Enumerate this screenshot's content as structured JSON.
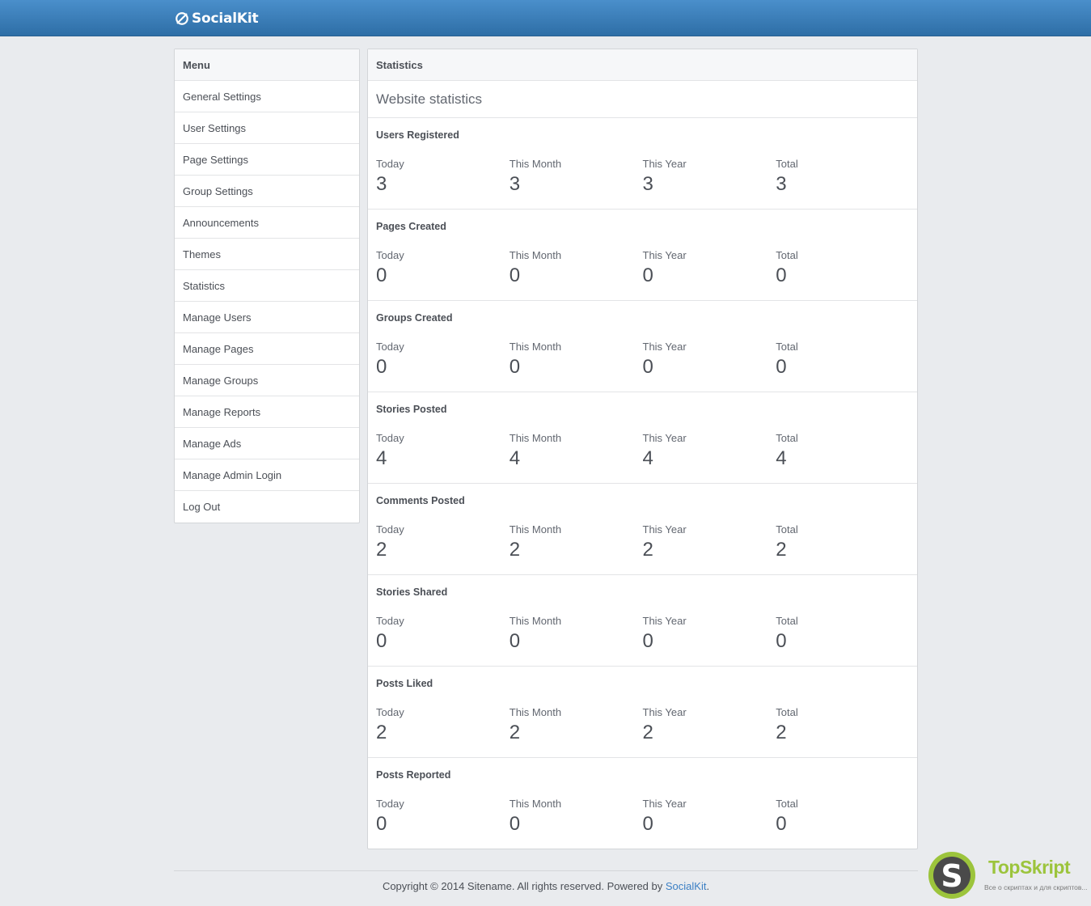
{
  "header": {
    "brand": "SocialKit"
  },
  "menu": {
    "title": "Menu",
    "items": [
      "General Settings",
      "User Settings",
      "Page Settings",
      "Group Settings",
      "Announcements",
      "Themes",
      "Statistics",
      "Manage Users",
      "Manage Pages",
      "Manage Groups",
      "Manage Reports",
      "Manage Ads",
      "Manage Admin Login",
      "Log Out"
    ]
  },
  "stats": {
    "title": "Statistics",
    "subtitle": "Website statistics",
    "column_labels": [
      "Today",
      "This Month",
      "This Year",
      "Total"
    ],
    "groups": [
      {
        "title": "Users Registered",
        "values": [
          "3",
          "3",
          "3",
          "3"
        ]
      },
      {
        "title": "Pages Created",
        "values": [
          "0",
          "0",
          "0",
          "0"
        ]
      },
      {
        "title": "Groups Created",
        "values": [
          "0",
          "0",
          "0",
          "0"
        ]
      },
      {
        "title": "Stories Posted",
        "values": [
          "4",
          "4",
          "4",
          "4"
        ]
      },
      {
        "title": "Comments Posted",
        "values": [
          "2",
          "2",
          "2",
          "2"
        ]
      },
      {
        "title": "Stories Shared",
        "values": [
          "0",
          "0",
          "0",
          "0"
        ]
      },
      {
        "title": "Posts Liked",
        "values": [
          "2",
          "2",
          "2",
          "2"
        ]
      },
      {
        "title": "Posts Reported",
        "values": [
          "0",
          "0",
          "0",
          "0"
        ]
      }
    ]
  },
  "footer": {
    "text": "Copyright © 2014 Sitename. All rights reserved. Powered by ",
    "link": "SocialKit",
    "end": "."
  },
  "watermark": {
    "name": "TopSkript",
    "tagline": "Все о скриптах и для скриптов..."
  },
  "colors": {
    "header_blue": "#3a7fbf",
    "link": "#3b7fc4",
    "accent_green": "#9cc43c"
  }
}
